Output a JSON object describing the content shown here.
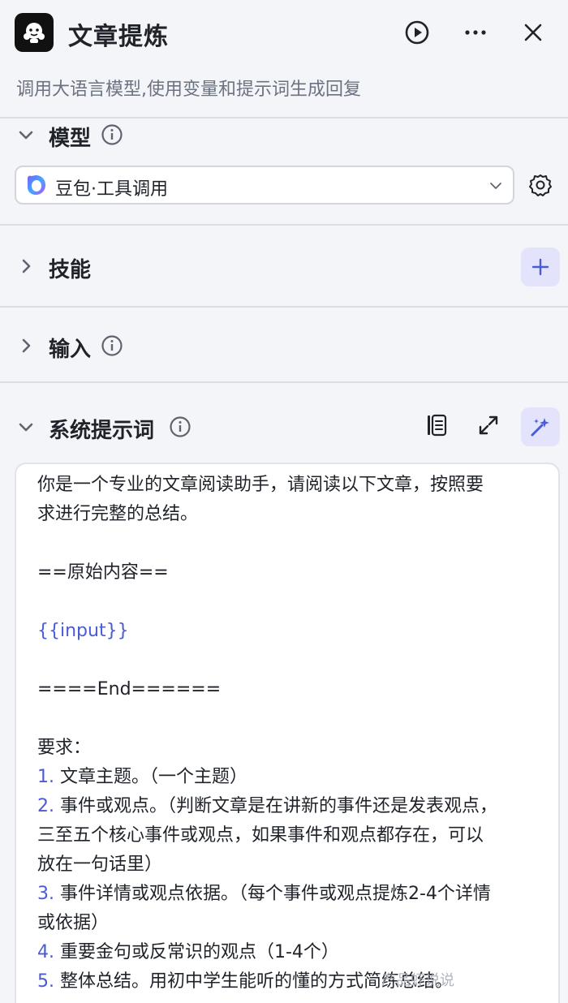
{
  "header": {
    "title": "文章提炼",
    "description": "调用大语言模型,使用变量和提示词生成回复"
  },
  "model_section": {
    "title": "模型",
    "selected_model": "豆包·工具调用"
  },
  "skills_section": {
    "title": "技能"
  },
  "input_section": {
    "title": "输入"
  },
  "system_prompt_section": {
    "title": "系统提示词",
    "lines": {
      "l0": "你是一个专业的文章阅读助手，请阅读以下文章，按照要",
      "l1": "求进行完整的总结。",
      "l2": "==原始内容==",
      "l3": "{{input}}",
      "l4": "====End======",
      "l5": "要求：",
      "i1_num": "1.",
      "i1": " 文章主题。（一个主题）",
      "i2_num": "2.",
      "i2a": " 事件或观点。（判断文章是在讲新的事件还是发表观点，",
      "i2b": "三至五个核心事件或观点，如果事件和观点都存在，可以",
      "i2c": "放在一句话里）",
      "i3_num": "3.",
      "i3a": " 事件详情或观点依据。（每个事件或观点提炼2-4个详情",
      "i3b": "或依据）",
      "i4_num": "4.",
      "i4": " 重要金句或反常识的观点（1-4个）",
      "i5_num": "5.",
      "i5": " 整体总结。用初中学生能听的懂的方式简练总结。"
    }
  },
  "watermark": "产品虾说说",
  "colors": {
    "accent": "#4a5bd4",
    "accent_bg": "#e3e4fb",
    "background": "#f4f5f9"
  }
}
